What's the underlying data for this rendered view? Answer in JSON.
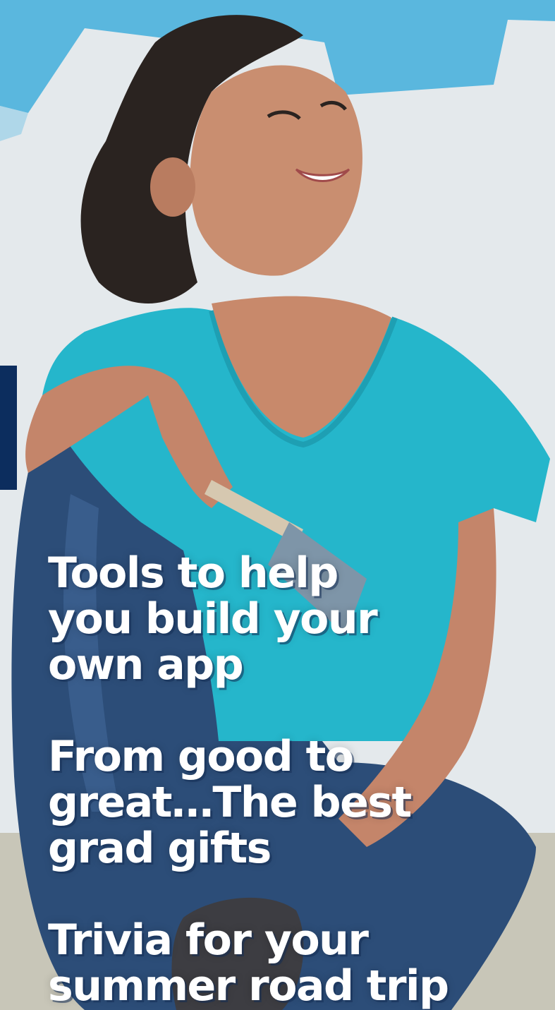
{
  "colors": {
    "nav_marker": "#0c2d5e",
    "paint_stroke": "#5ab7de",
    "shirt": "#25b6cb",
    "jeans": "#2c4d78",
    "headline_text": "#ffffff"
  },
  "hero": {
    "image": "woman-holding-paintbrush-photo"
  },
  "stories": [
    {
      "lines": [
        "Tools to help",
        "you build your",
        "own app"
      ]
    },
    {
      "lines": [
        "From good to",
        "great…The best",
        "grad gifts"
      ]
    },
    {
      "lines": [
        "Trivia for your",
        "summer road trip"
      ]
    }
  ]
}
